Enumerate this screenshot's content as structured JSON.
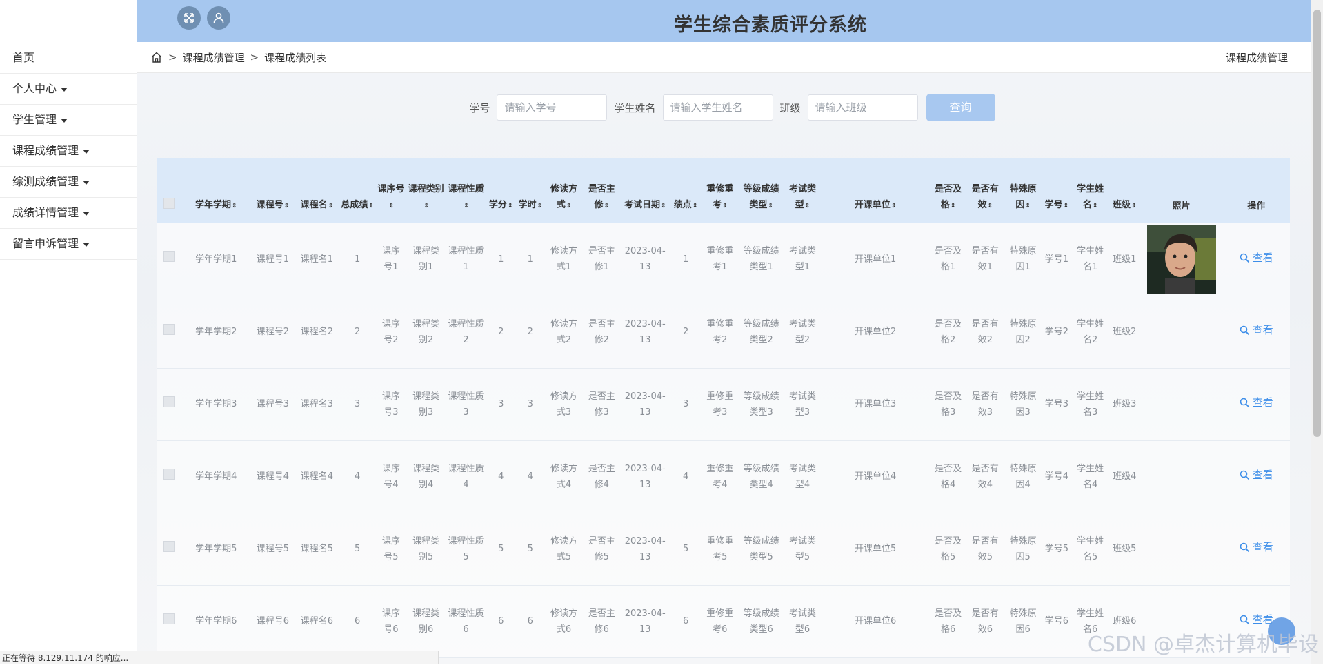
{
  "header": {
    "title": "学生综合素质评分系统"
  },
  "sidebar": {
    "items": [
      {
        "label": "首页",
        "caret": false
      },
      {
        "label": "个人中心",
        "caret": true
      },
      {
        "label": "学生管理",
        "caret": true
      },
      {
        "label": "课程成绩管理",
        "caret": true
      },
      {
        "label": "综测成绩管理",
        "caret": true
      },
      {
        "label": "成绩详情管理",
        "caret": true
      },
      {
        "label": "留言申诉管理",
        "caret": true
      }
    ]
  },
  "breadcrumb": {
    "level1": "课程成绩管理",
    "level2": "课程成绩列表",
    "right": "课程成绩管理"
  },
  "search": {
    "student_id_label": "学号",
    "student_id_placeholder": "请输入学号",
    "student_name_label": "学生姓名",
    "student_name_placeholder": "请输入学生姓名",
    "class_label": "班级",
    "class_placeholder": "请输入班级",
    "query_button": "查询"
  },
  "table": {
    "sort_glyph": "⇕",
    "headers": [
      "学年学期",
      "课程号",
      "课程名",
      "总成绩",
      "课序号",
      "课程类别",
      "课程性质",
      "学分",
      "学时",
      "修读方式",
      "是否主修",
      "考试日期",
      "绩点",
      "重修重考",
      "等级成绩类型",
      "考试类型",
      "开课单位",
      "是否及格",
      "是否有效",
      "特殊原因",
      "学号",
      "学生姓名",
      "班级",
      "照片",
      "操作"
    ],
    "view_label": "查看",
    "rows": [
      [
        "学年学期1",
        "课程号1",
        "课程名1",
        "1",
        "课序号1",
        "课程类别1",
        "课程性质1",
        "1",
        "1",
        "修读方式1",
        "是否主修1",
        "2023-04-13",
        "1",
        "重修重考1",
        "等级成绩类型1",
        "考试类型1",
        "开课单位1",
        "是否及格1",
        "是否有效1",
        "特殊原因1",
        "学号1",
        "学生姓名1",
        "班级1"
      ],
      [
        "学年学期2",
        "课程号2",
        "课程名2",
        "2",
        "课序号2",
        "课程类别2",
        "课程性质2",
        "2",
        "2",
        "修读方式2",
        "是否主修2",
        "2023-04-13",
        "2",
        "重修重考2",
        "等级成绩类型2",
        "考试类型2",
        "开课单位2",
        "是否及格2",
        "是否有效2",
        "特殊原因2",
        "学号2",
        "学生姓名2",
        "班级2"
      ],
      [
        "学年学期3",
        "课程号3",
        "课程名3",
        "3",
        "课序号3",
        "课程类别3",
        "课程性质3",
        "3",
        "3",
        "修读方式3",
        "是否主修3",
        "2023-04-13",
        "3",
        "重修重考3",
        "等级成绩类型3",
        "考试类型3",
        "开课单位3",
        "是否及格3",
        "是否有效3",
        "特殊原因3",
        "学号3",
        "学生姓名3",
        "班级3"
      ],
      [
        "学年学期4",
        "课程号4",
        "课程名4",
        "4",
        "课序号4",
        "课程类别4",
        "课程性质4",
        "4",
        "4",
        "修读方式4",
        "是否主修4",
        "2023-04-13",
        "4",
        "重修重考4",
        "等级成绩类型4",
        "考试类型4",
        "开课单位4",
        "是否及格4",
        "是否有效4",
        "特殊原因4",
        "学号4",
        "学生姓名4",
        "班级4"
      ],
      [
        "学年学期5",
        "课程号5",
        "课程名5",
        "5",
        "课序号5",
        "课程类别5",
        "课程性质5",
        "5",
        "5",
        "修读方式5",
        "是否主修5",
        "2023-04-13",
        "5",
        "重修重考5",
        "等级成绩类型5",
        "考试类型5",
        "开课单位5",
        "是否及格5",
        "是否有效5",
        "特殊原因5",
        "学号5",
        "学生姓名5",
        "班级5"
      ],
      [
        "学年学期6",
        "课程号6",
        "课程名6",
        "6",
        "课序号6",
        "课程类别6",
        "课程性质6",
        "6",
        "6",
        "修读方式6",
        "是否主修6",
        "2023-04-13",
        "6",
        "重修重考6",
        "等级成绩类型6",
        "考试类型6",
        "开课单位6",
        "是否及格6",
        "是否有效6",
        "特殊原因6",
        "学号6",
        "学生姓名6",
        "班级6"
      ]
    ]
  },
  "status_bar": {
    "text": "正在等待 8.129.11.174 的响应..."
  },
  "watermark": "CSDN @卓杰计算机毕设",
  "colors": {
    "header_bg": "#a6c7ef",
    "table_header_bg": "#dbe9f9",
    "link": "#3d8ee9",
    "button_bg": "#a8c8f0"
  },
  "icons": {
    "fullscreen": "expand-icon",
    "user": "user-icon",
    "home": "home-icon",
    "view": "search-icon"
  }
}
